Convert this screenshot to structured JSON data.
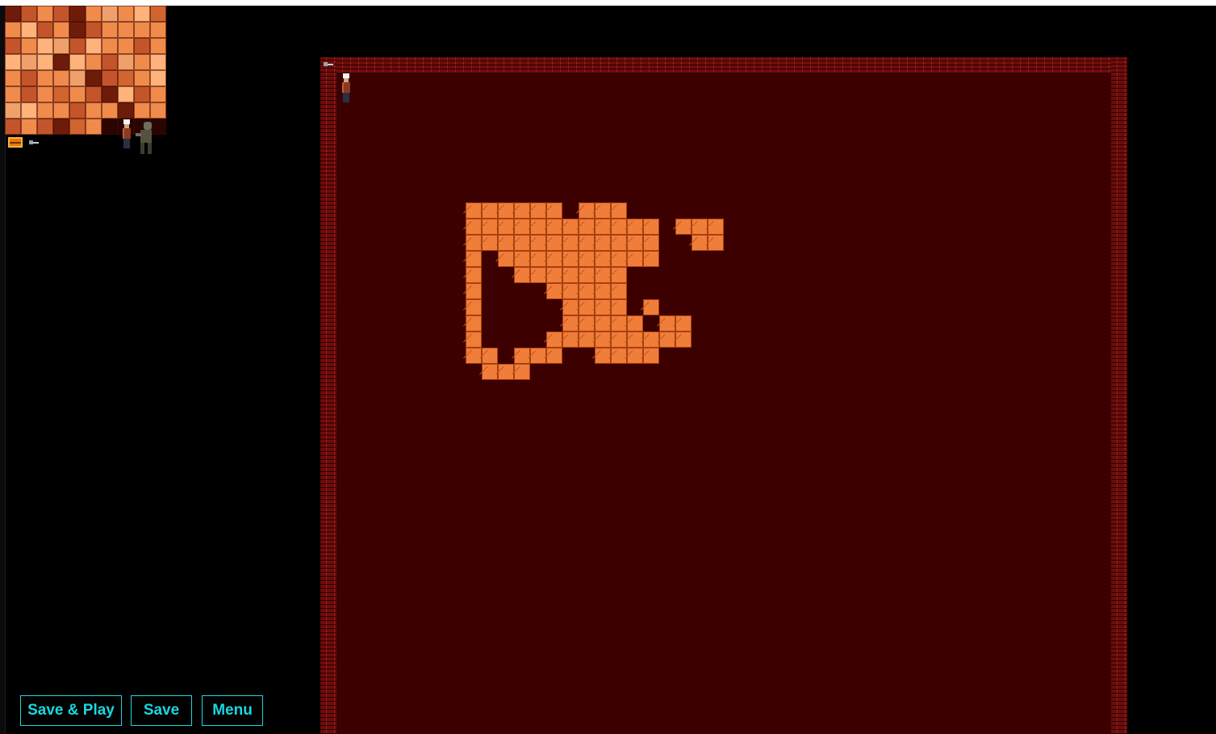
{
  "editor": {
    "buttons": {
      "save_play": "Save & Play",
      "save": "Save",
      "menu": "Menu"
    },
    "colors": {
      "button_accent": "#19d7e0",
      "map_floor": "#3c0000",
      "wall_brick": "#6c0c0c",
      "floor_tile": "#f07d3a",
      "background": "#000000"
    },
    "palette": {
      "tiles": [
        "#6e1c0a",
        "#c4552a",
        "#f08b4c",
        "#c4552a",
        "#6e1c0a",
        "#f08b4c",
        "#f0a06a",
        "#f08b4c",
        "#ffb27a",
        "#d0652f",
        "#f08b4c",
        "#ffb27a",
        "#c4552a",
        "#f08b4c",
        "#6e1c0a",
        "#c4552a",
        "#f08b4c",
        "#f08b4c",
        "#f08b4c",
        "#f08b4c",
        "#c4552a",
        "#f08b4c",
        "#ffb27a",
        "#f0a06a",
        "#c4552a",
        "#ffb27a",
        "#f08b4c",
        "#f08b4c",
        "#c4552a",
        "#f08b4c",
        "#ffb27a",
        "#f0a06a",
        "#ffb27a",
        "#6e1c0a",
        "#ffb27a",
        "#f08b4c",
        "#c4552a",
        "#f0a06a",
        "#f08b4c",
        "#ffb27a",
        "#f08b4c",
        "#c4552a",
        "#f08b4c",
        "#f08b4c",
        "#f0a06a",
        "#6e1c0a",
        "#c4552a",
        "#d0652f",
        "#f08b4c",
        "#ffb27a",
        "#f08b4c",
        "#c4552a",
        "#f08b4c",
        "#d0652f",
        "#f08b4c",
        "#c4552a",
        "#6e1c0a",
        "#ffb27a",
        "#c4552a",
        "#f08b4c",
        "#f0a06a",
        "#ffb27a",
        "#f08b4c",
        "#f08b4c",
        "#c4552a",
        "#f08b4c",
        "#f08b4c",
        "#6e1c0a",
        "#f08b4c",
        "#f08b4c",
        "#c4552a",
        "#f08b4c",
        "#c4552a",
        "#6e1c0a",
        "#d0652f",
        "#f08b4c",
        "#2a0500",
        "#2a0500",
        "#2a0500",
        "#2a0500"
      ],
      "sprites": [
        "treasure-chest",
        "key",
        "hero",
        "zombie"
      ]
    },
    "map": {
      "tiles": [
        [
          9,
          9
        ],
        [
          10,
          9
        ],
        [
          11,
          9
        ],
        [
          12,
          9
        ],
        [
          13,
          9
        ],
        [
          14,
          9
        ],
        [
          16,
          9
        ],
        [
          17,
          9
        ],
        [
          18,
          9
        ],
        [
          9,
          10
        ],
        [
          10,
          10
        ],
        [
          11,
          10
        ],
        [
          12,
          10
        ],
        [
          13,
          10
        ],
        [
          14,
          10
        ],
        [
          15,
          10
        ],
        [
          16,
          10
        ],
        [
          17,
          10
        ],
        [
          18,
          10
        ],
        [
          19,
          10
        ],
        [
          20,
          10
        ],
        [
          22,
          10
        ],
        [
          23,
          10
        ],
        [
          24,
          10
        ],
        [
          9,
          11
        ],
        [
          10,
          11
        ],
        [
          11,
          11
        ],
        [
          12,
          11
        ],
        [
          13,
          11
        ],
        [
          14,
          11
        ],
        [
          15,
          11
        ],
        [
          16,
          11
        ],
        [
          17,
          11
        ],
        [
          18,
          11
        ],
        [
          19,
          11
        ],
        [
          20,
          11
        ],
        [
          23,
          11
        ],
        [
          24,
          11
        ],
        [
          9,
          12
        ],
        [
          11,
          12
        ],
        [
          12,
          12
        ],
        [
          13,
          12
        ],
        [
          14,
          12
        ],
        [
          15,
          12
        ],
        [
          16,
          12
        ],
        [
          17,
          12
        ],
        [
          18,
          12
        ],
        [
          19,
          12
        ],
        [
          20,
          12
        ],
        [
          9,
          13
        ],
        [
          12,
          13
        ],
        [
          13,
          13
        ],
        [
          14,
          13
        ],
        [
          15,
          13
        ],
        [
          16,
          13
        ],
        [
          17,
          13
        ],
        [
          18,
          13
        ],
        [
          9,
          14
        ],
        [
          14,
          14
        ],
        [
          15,
          14
        ],
        [
          16,
          14
        ],
        [
          17,
          14
        ],
        [
          18,
          14
        ],
        [
          9,
          15
        ],
        [
          15,
          15
        ],
        [
          16,
          15
        ],
        [
          17,
          15
        ],
        [
          18,
          15
        ],
        [
          20,
          15
        ],
        [
          9,
          16
        ],
        [
          15,
          16
        ],
        [
          16,
          16
        ],
        [
          17,
          16
        ],
        [
          18,
          16
        ],
        [
          19,
          16
        ],
        [
          21,
          16
        ],
        [
          22,
          16
        ],
        [
          9,
          17
        ],
        [
          14,
          17
        ],
        [
          15,
          17
        ],
        [
          16,
          17
        ],
        [
          17,
          17
        ],
        [
          18,
          17
        ],
        [
          19,
          17
        ],
        [
          20,
          17
        ],
        [
          21,
          17
        ],
        [
          22,
          17
        ],
        [
          9,
          18
        ],
        [
          10,
          18
        ],
        [
          12,
          18
        ],
        [
          13,
          18
        ],
        [
          14,
          18
        ],
        [
          17,
          18
        ],
        [
          18,
          18
        ],
        [
          19,
          18
        ],
        [
          20,
          18
        ],
        [
          10,
          19
        ],
        [
          11,
          19
        ],
        [
          12,
          19
        ]
      ]
    }
  }
}
